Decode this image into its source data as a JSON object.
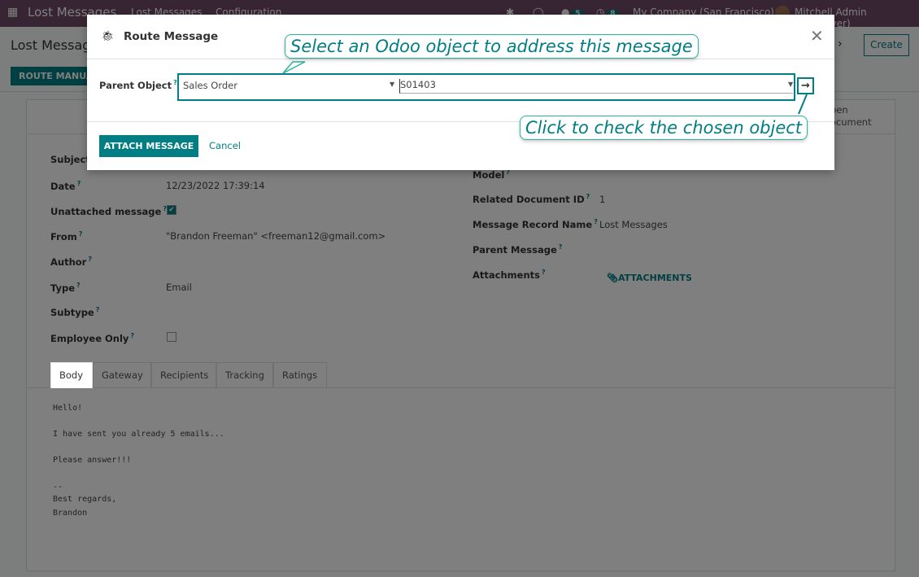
{
  "navbar": {
    "app": "Lost Messages",
    "menu": [
      "Lost Messages",
      "Configuration"
    ],
    "chat_count": "5",
    "activity_count": "8",
    "company": "My Company (San Francisco)",
    "user": "Mitchell Admin (16_server)"
  },
  "control": {
    "title": "Lost Messages",
    "create": "Create",
    "route_manually": "ROUTE MANUALLY"
  },
  "smart_button": {
    "line1": "Open",
    "line2": "Document"
  },
  "form": {
    "left": [
      {
        "label": "Subject",
        "value": ""
      },
      {
        "label": "Date",
        "value": "12/23/2022 17:39:14"
      },
      {
        "label": "Unattached message",
        "value": "checked"
      },
      {
        "label": "From",
        "value": "\"Brandon Freeman\" <freeman12@gmail.com>"
      },
      {
        "label": "Author",
        "value": ""
      },
      {
        "label": "Type",
        "value": "Email"
      },
      {
        "label": "Subtype",
        "value": ""
      },
      {
        "label": "Employee Only",
        "value": "unchecked"
      }
    ],
    "right": [
      {
        "label": "Model",
        "value": ""
      },
      {
        "label": "Related Document ID",
        "value": "1"
      },
      {
        "label": "Message Record Name",
        "value": "Lost Messages"
      },
      {
        "label": "Parent Message",
        "value": ""
      },
      {
        "label": "Attachments",
        "value": "ATTACHMENTS"
      }
    ]
  },
  "tabs": [
    "Body",
    "Gateway",
    "Recipients",
    "Tracking",
    "Ratings"
  ],
  "body_lines": [
    "Hello!",
    "I have sent you already 5 emails...",
    "Please answer!!!",
    "--",
    "Best regards,",
    "Brandon"
  ],
  "dialog": {
    "title": "Route Message",
    "parent_label": "Parent Object",
    "model": "Sales Order",
    "record": "S01403",
    "attach": "ATTACH MESSAGE",
    "cancel": "Cancel"
  },
  "callouts": {
    "top": "Select an Odoo object to address this message",
    "bottom": "Click to check the chosen object"
  },
  "colors": {
    "brand": "#714b67",
    "accent": "#017e84"
  }
}
